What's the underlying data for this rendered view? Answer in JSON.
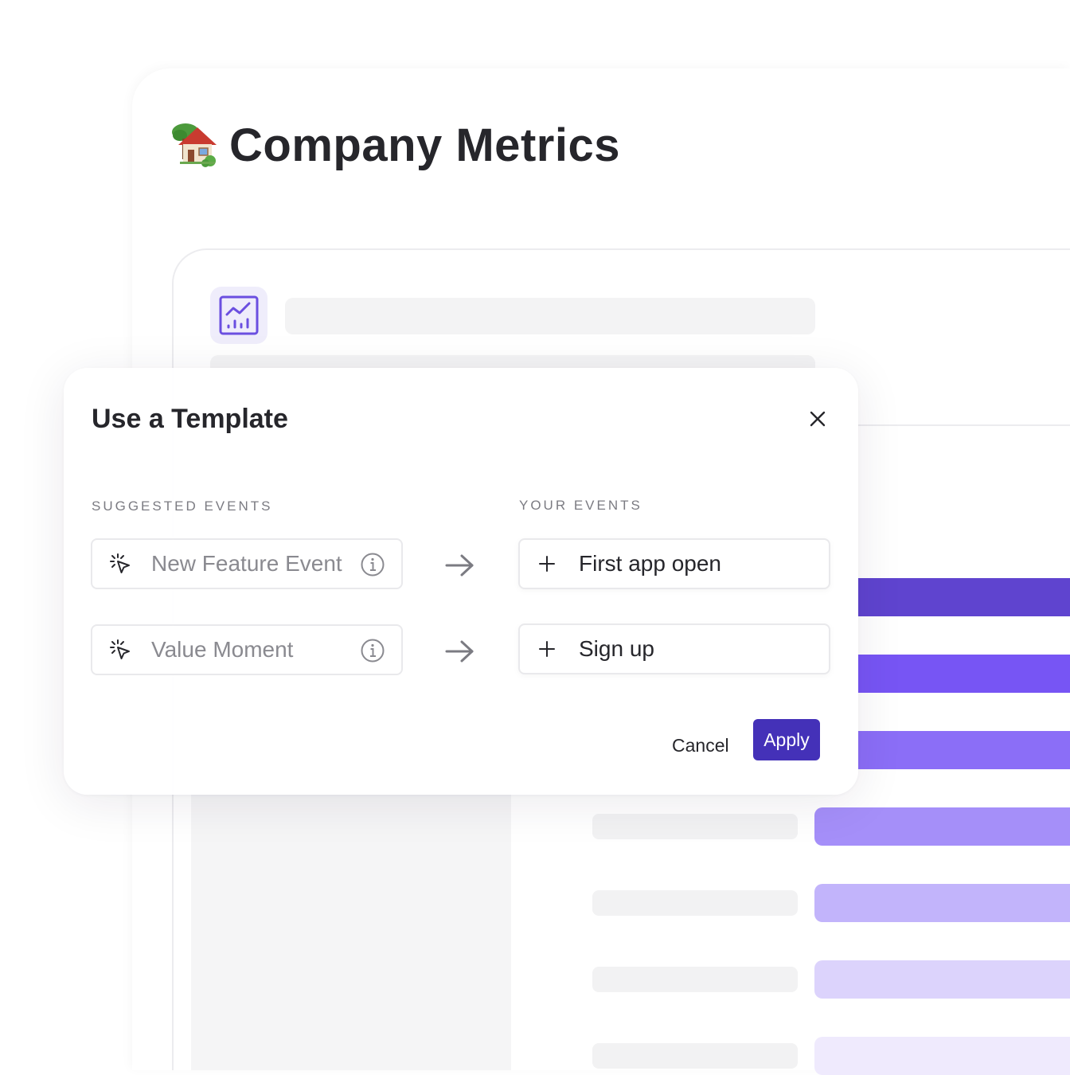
{
  "page": {
    "title": "Company Metrics",
    "icon": "house-with-garden-icon"
  },
  "report": {
    "icon": "line-chart-icon",
    "bar_colors": [
      "#5f44cf",
      "#7755f4",
      "#8b6ef7",
      "#a58ff9",
      "#c2b4fb",
      "#dcd3fc",
      "#efeafd"
    ]
  },
  "modal": {
    "title": "Use a Template",
    "close_icon": "close-icon",
    "suggested_header": "SUGGESTED EVENTS",
    "your_header": "YOUR EVENTS",
    "suggested_events": [
      {
        "label": "New Feature Event",
        "icon": "sparkle-cursor-icon",
        "info_icon": "info-icon"
      },
      {
        "label": "Value Moment",
        "icon": "sparkle-cursor-icon",
        "info_icon": "info-icon"
      }
    ],
    "your_events": [
      {
        "label": "First app open",
        "icon": "plus-icon"
      },
      {
        "label": "Sign up",
        "icon": "plus-icon"
      }
    ],
    "cancel_label": "Cancel",
    "apply_label": "Apply",
    "accent_color": "#4431b8"
  }
}
